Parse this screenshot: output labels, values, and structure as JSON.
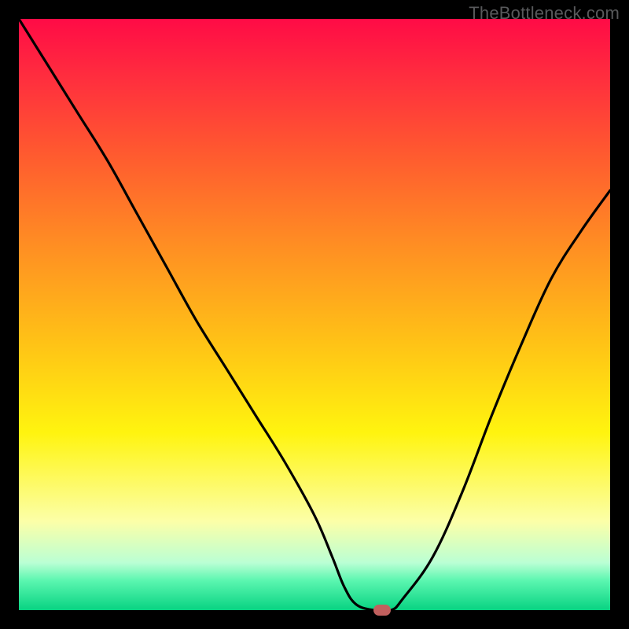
{
  "watermark": "TheBottleneck.com",
  "colors": {
    "gradient_top": "#ff0b46",
    "gradient_mid": "#fff40f",
    "gradient_bottom": "#08d382",
    "curve": "#000000",
    "marker": "#c1605e",
    "border": "#000000"
  },
  "chart_data": {
    "type": "line",
    "title": "",
    "xlabel": "",
    "ylabel": "",
    "xlim": [
      0,
      100
    ],
    "ylim": [
      0,
      100
    ],
    "series": [
      {
        "name": "bottleneck-curve",
        "x": [
          0,
          5,
          10,
          15,
          20,
          25,
          30,
          35,
          40,
          45,
          50,
          53,
          55,
          57,
          60,
          63,
          65,
          70,
          75,
          80,
          85,
          90,
          95,
          100
        ],
        "y": [
          100,
          92,
          84,
          76,
          67,
          58,
          49,
          41,
          33,
          25,
          16,
          9,
          4,
          1,
          0,
          0,
          2,
          9,
          20,
          33,
          45,
          56,
          64,
          71
        ]
      }
    ],
    "marker": {
      "x": 61.5,
      "y": 0,
      "label": ""
    },
    "grid": false,
    "legend": false
  }
}
